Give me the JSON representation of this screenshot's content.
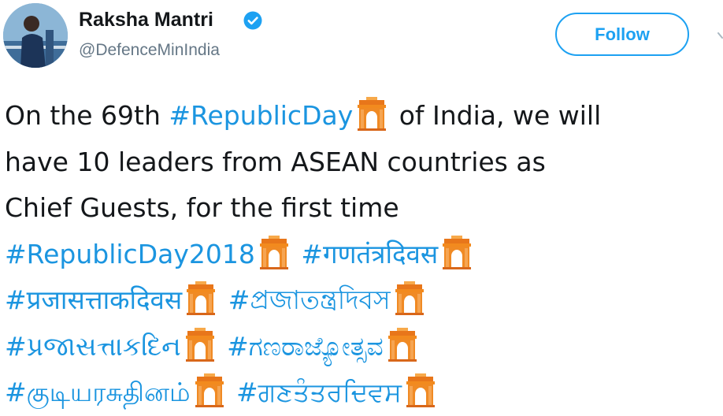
{
  "profile": {
    "name": "Raksha Mantri",
    "handle": "@DefenceMinIndia",
    "verified": true,
    "avatar": "avatar-photo"
  },
  "follow_button": {
    "label": "Follow"
  },
  "menu": {
    "icon": "chevron-down-icon"
  },
  "tweet": {
    "text_1": "On the 69th",
    "hashtag_1": "#RepublicDay",
    "text_2": "of India, we will",
    "text_3": "have 10 leaders from ASEAN countries as",
    "text_4": "Chief Guests, for the first time",
    "hashtags": [
      "#RepublicDay2018",
      "#गणतंत्रदिवस",
      "#प्रजासत्ताकदिवस",
      "#প্রজাতন্ত্রদিবস",
      "#પ્રજાસત્તાકદિન",
      "#ಗಣರಾಜ್ಯೋತ್ಸವ",
      "#குடியரசுதினம்",
      "#ਗਣਤੰਤਰਦਿਵਸ"
    ],
    "emoji": "india-gate-icon"
  },
  "colors": {
    "accent": "#1da1f2",
    "hashtag": "#1b95e0",
    "text": "#14171a",
    "secondary": "#657786",
    "emoji": "#f28a1e"
  }
}
